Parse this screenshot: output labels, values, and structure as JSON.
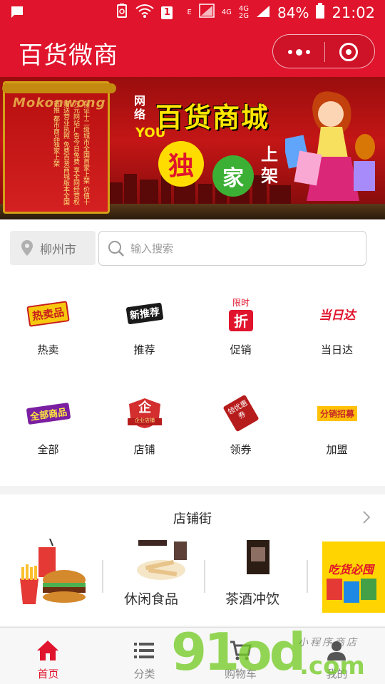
{
  "status_bar": {
    "signal_4g_1": "4G",
    "signal_4g_2": "4G",
    "signal_2g": "2G",
    "e_label": "E",
    "sim_badge": "1",
    "battery_percent": "84%",
    "time": "21:02"
  },
  "header": {
    "title": "百货微商"
  },
  "banner": {
    "brand_en": "Mokonwong",
    "net_label": "网络",
    "you_label": "YOU",
    "title": "百货商城",
    "circle_1": "独",
    "circle_2": "家",
    "tag": "上架",
    "scroll_text": "保证十二级城市全国首家上架 价值十万元网站广告今日免费 享全网经营权赠送营业执照 免费百货商城版本全国首推 都市商品独家上架"
  },
  "search": {
    "city": "柳州市",
    "placeholder": "输入搜索"
  },
  "categories": [
    {
      "label": "热卖",
      "icon": "hot-sale-icon",
      "art": "热卖品"
    },
    {
      "label": "推荐",
      "icon": "recommend-icon",
      "art": "新推荐"
    },
    {
      "label": "促销",
      "icon": "promotion-icon",
      "art_top": "限时",
      "art": "折"
    },
    {
      "label": "当日达",
      "icon": "same-day-icon",
      "art": "当日达"
    },
    {
      "label": "全部",
      "icon": "all-products-icon",
      "art": "全部商品"
    },
    {
      "label": "店铺",
      "icon": "store-icon",
      "art": "企",
      "art_sub": "企业店铺"
    },
    {
      "label": "领券",
      "icon": "coupon-icon",
      "art": "领优惠券"
    },
    {
      "label": "加盟",
      "icon": "join-icon",
      "art": "分销招募"
    }
  ],
  "store_street": {
    "title": "店铺街",
    "tiles": [
      {
        "label": ""
      },
      {
        "label": "休闲食品"
      },
      {
        "label": "茶酒冲饮"
      },
      {
        "label": "",
        "art": "吃货必囤"
      }
    ]
  },
  "bottom_nav": [
    {
      "label": "首页",
      "icon": "home-icon",
      "active": true
    },
    {
      "label": "分类",
      "icon": "category-list-icon",
      "active": false
    },
    {
      "label": "购物车",
      "icon": "cart-icon",
      "active": false
    },
    {
      "label": "我的",
      "icon": "user-icon",
      "active": false
    }
  ],
  "watermark": {
    "big": "91od",
    "domain": ".com",
    "small": "小程序商店"
  },
  "colors": {
    "brand_red": "#e0142c",
    "active_nav": "#e0142c",
    "inactive_nav": "#888888"
  }
}
